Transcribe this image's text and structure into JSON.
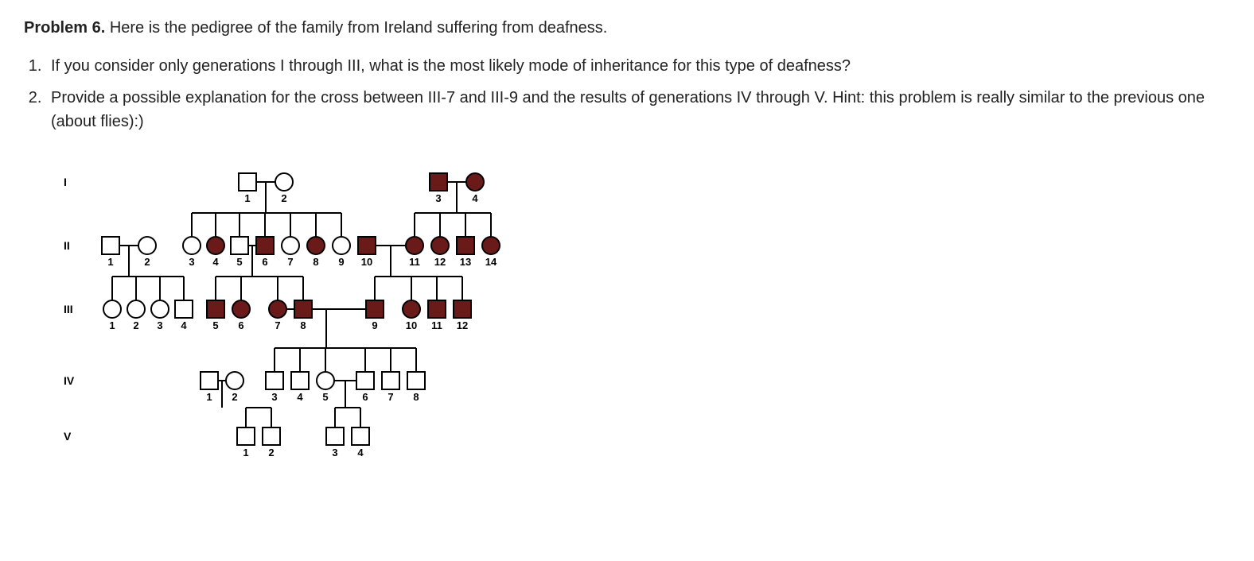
{
  "problem_label": "Problem 6.",
  "intro_text": "  Here is the pedigree of the family from Ireland suffering from deafness.",
  "questions": [
    "If you consider only generations I through III, what is the most likely mode of inheritance for this type of deafness?",
    "Provide a possible explanation for the cross between III-7 and III-9 and the results of generations IV through V.  Hint: this problem is really similar to the previous one (about flies):)"
  ],
  "gen_labels": {
    "I": "I",
    "II": "II",
    "III": "III",
    "IV": "IV",
    "V": "V"
  },
  "chart_data": {
    "type": "pedigree",
    "legend": {
      "square": "male",
      "circle": "female",
      "filled": "affected (deaf)",
      "open": "unaffected"
    },
    "generations": [
      {
        "id": "I",
        "individuals": [
          {
            "n": 1,
            "sex": "M",
            "aff": false
          },
          {
            "n": 2,
            "sex": "F",
            "aff": false
          },
          {
            "n": 3,
            "sex": "M",
            "aff": true
          },
          {
            "n": 4,
            "sex": "F",
            "aff": true
          }
        ],
        "matings": [
          [
            1,
            2
          ],
          [
            3,
            4
          ]
        ]
      },
      {
        "id": "II",
        "individuals": [
          {
            "n": 1,
            "sex": "M",
            "aff": false
          },
          {
            "n": 2,
            "sex": "F",
            "aff": false
          },
          {
            "n": 3,
            "sex": "F",
            "aff": false
          },
          {
            "n": 4,
            "sex": "F",
            "aff": true
          },
          {
            "n": 5,
            "sex": "M",
            "aff": false
          },
          {
            "n": 6,
            "sex": "M",
            "aff": true
          },
          {
            "n": 7,
            "sex": "F",
            "aff": false
          },
          {
            "n": 8,
            "sex": "F",
            "aff": true
          },
          {
            "n": 9,
            "sex": "F",
            "aff": false
          },
          {
            "n": 10,
            "sex": "M",
            "aff": true
          },
          {
            "n": 11,
            "sex": "F",
            "aff": true
          },
          {
            "n": 12,
            "sex": "F",
            "aff": true
          },
          {
            "n": 13,
            "sex": "M",
            "aff": true
          },
          {
            "n": 14,
            "sex": "F",
            "aff": true
          }
        ],
        "matings": [
          [
            1,
            2
          ],
          [
            5,
            6
          ],
          [
            10,
            11
          ]
        ],
        "parents": {
          "3-9": [
            "I",
            1,
            2
          ],
          "11-14": [
            "I",
            3,
            4
          ]
        }
      },
      {
        "id": "III",
        "individuals": [
          {
            "n": 1,
            "sex": "F",
            "aff": false
          },
          {
            "n": 2,
            "sex": "F",
            "aff": false
          },
          {
            "n": 3,
            "sex": "F",
            "aff": false
          },
          {
            "n": 4,
            "sex": "M",
            "aff": false
          },
          {
            "n": 5,
            "sex": "M",
            "aff": true
          },
          {
            "n": 6,
            "sex": "F",
            "aff": true
          },
          {
            "n": 7,
            "sex": "F",
            "aff": true
          },
          {
            "n": 8,
            "sex": "M",
            "aff": true
          },
          {
            "n": 9,
            "sex": "M",
            "aff": true
          },
          {
            "n": 10,
            "sex": "F",
            "aff": true
          },
          {
            "n": 11,
            "sex": "M",
            "aff": true
          },
          {
            "n": 12,
            "sex": "M",
            "aff": true
          }
        ],
        "matings": [
          [
            7,
            9
          ]
        ],
        "parents": {
          "1-4": [
            "II",
            1,
            2
          ],
          "5-8": [
            "II",
            5,
            6
          ],
          "9-12": [
            "II",
            10,
            11
          ]
        }
      },
      {
        "id": "IV",
        "individuals": [
          {
            "n": 1,
            "sex": "M",
            "aff": false
          },
          {
            "n": 2,
            "sex": "F",
            "aff": false
          },
          {
            "n": 3,
            "sex": "M",
            "aff": false
          },
          {
            "n": 4,
            "sex": "M",
            "aff": false
          },
          {
            "n": 5,
            "sex": "F",
            "aff": false
          },
          {
            "n": 6,
            "sex": "M",
            "aff": false
          },
          {
            "n": 7,
            "sex": "M",
            "aff": false
          },
          {
            "n": 8,
            "sex": "M",
            "aff": false
          }
        ],
        "matings": [
          [
            1,
            2
          ],
          [
            5,
            6
          ]
        ],
        "parents": {
          "3-8": [
            "III",
            7,
            9
          ]
        }
      },
      {
        "id": "V",
        "individuals": [
          {
            "n": 1,
            "sex": "M",
            "aff": false
          },
          {
            "n": 2,
            "sex": "M",
            "aff": false
          },
          {
            "n": 3,
            "sex": "M",
            "aff": false
          },
          {
            "n": 4,
            "sex": "M",
            "aff": false
          }
        ],
        "parents": {
          "1-2": [
            "IV",
            1,
            2
          ],
          "3-4": [
            "IV",
            5,
            6
          ]
        }
      }
    ]
  }
}
